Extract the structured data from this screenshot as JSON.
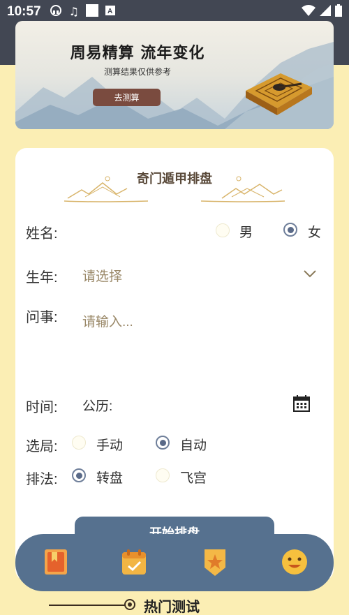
{
  "status_bar": {
    "time": "10:57"
  },
  "banner": {
    "title": "周易精算 流年变化",
    "subtitle": "测算结果仅供参考",
    "button": "去测算"
  },
  "form": {
    "title": "奇门遁甲排盘",
    "name_label": "姓名:",
    "gender": {
      "male": "男",
      "female": "女",
      "selected": "女"
    },
    "birth_year_label": "生年:",
    "birth_year_placeholder": "请选择",
    "question_label": "问事:",
    "question_placeholder": "请输入...",
    "time_label": "时间:",
    "time_calendar": "公历:",
    "layout_label": "选局:",
    "layout": {
      "manual": "手动",
      "auto": "自动",
      "selected": "自动"
    },
    "method_label": "排法:",
    "method": {
      "rotate": "转盘",
      "fly": "飞宫",
      "selected": "转盘"
    },
    "start_button": "开始排盘"
  },
  "bottom_nav": {
    "items": [
      "bookmark-icon",
      "calendar-check-icon",
      "star-badge-icon",
      "smile-icon"
    ]
  },
  "hot_section": {
    "title": "热门测试"
  },
  "colors": {
    "background": "#fbeeb4",
    "accent_blue": "#56718f",
    "banner_button": "#7a4b3f",
    "status_bar": "#424753"
  }
}
